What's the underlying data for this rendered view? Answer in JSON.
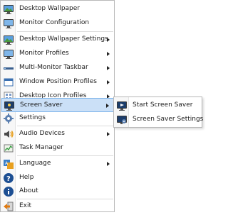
{
  "menu": {
    "items": [
      {
        "label": "Desktop Wallpaper",
        "icon": "desktop-wallpaper-icon"
      },
      {
        "label": "Monitor Configuration",
        "icon": "monitor-configuration-icon"
      },
      {
        "label": "Desktop Wallpaper Settings",
        "icon": "desktop-wallpaper-settings-icon",
        "has_submenu": true
      },
      {
        "label": "Monitor Profiles",
        "icon": "monitor-profiles-icon",
        "has_submenu": true
      },
      {
        "label": "Multi-Monitor Taskbar",
        "icon": "multi-monitor-taskbar-icon",
        "has_submenu": true
      },
      {
        "label": "Window Position Profiles",
        "icon": "window-position-profiles-icon",
        "has_submenu": true
      },
      {
        "label": "Desktop Icon Profiles",
        "icon": "desktop-icon-profiles-icon",
        "has_submenu": true
      },
      {
        "label": "Screen Saver",
        "icon": "screen-saver-icon",
        "has_submenu": true,
        "selected": true
      },
      {
        "label": "Settings",
        "icon": "settings-gear-icon"
      },
      {
        "label": "Audio Devices",
        "icon": "audio-devices-icon",
        "has_submenu": true
      },
      {
        "label": "Task Manager",
        "icon": "task-manager-icon"
      },
      {
        "label": "Language",
        "icon": "language-icon",
        "has_submenu": true
      },
      {
        "label": "Help",
        "icon": "help-icon"
      },
      {
        "label": "About",
        "icon": "about-info-icon"
      },
      {
        "label": "Exit",
        "icon": "exit-icon"
      }
    ]
  },
  "submenu": {
    "items": [
      {
        "label": "Start Screen Saver",
        "icon": "start-screen-saver-icon"
      },
      {
        "label": "Screen Saver Settings",
        "icon": "screen-saver-settings-icon"
      }
    ]
  },
  "colors": {
    "selection_bg": "#cbe0f7",
    "selection_border": "#7eb4ea",
    "icon_blue": "#2f6fb7"
  }
}
